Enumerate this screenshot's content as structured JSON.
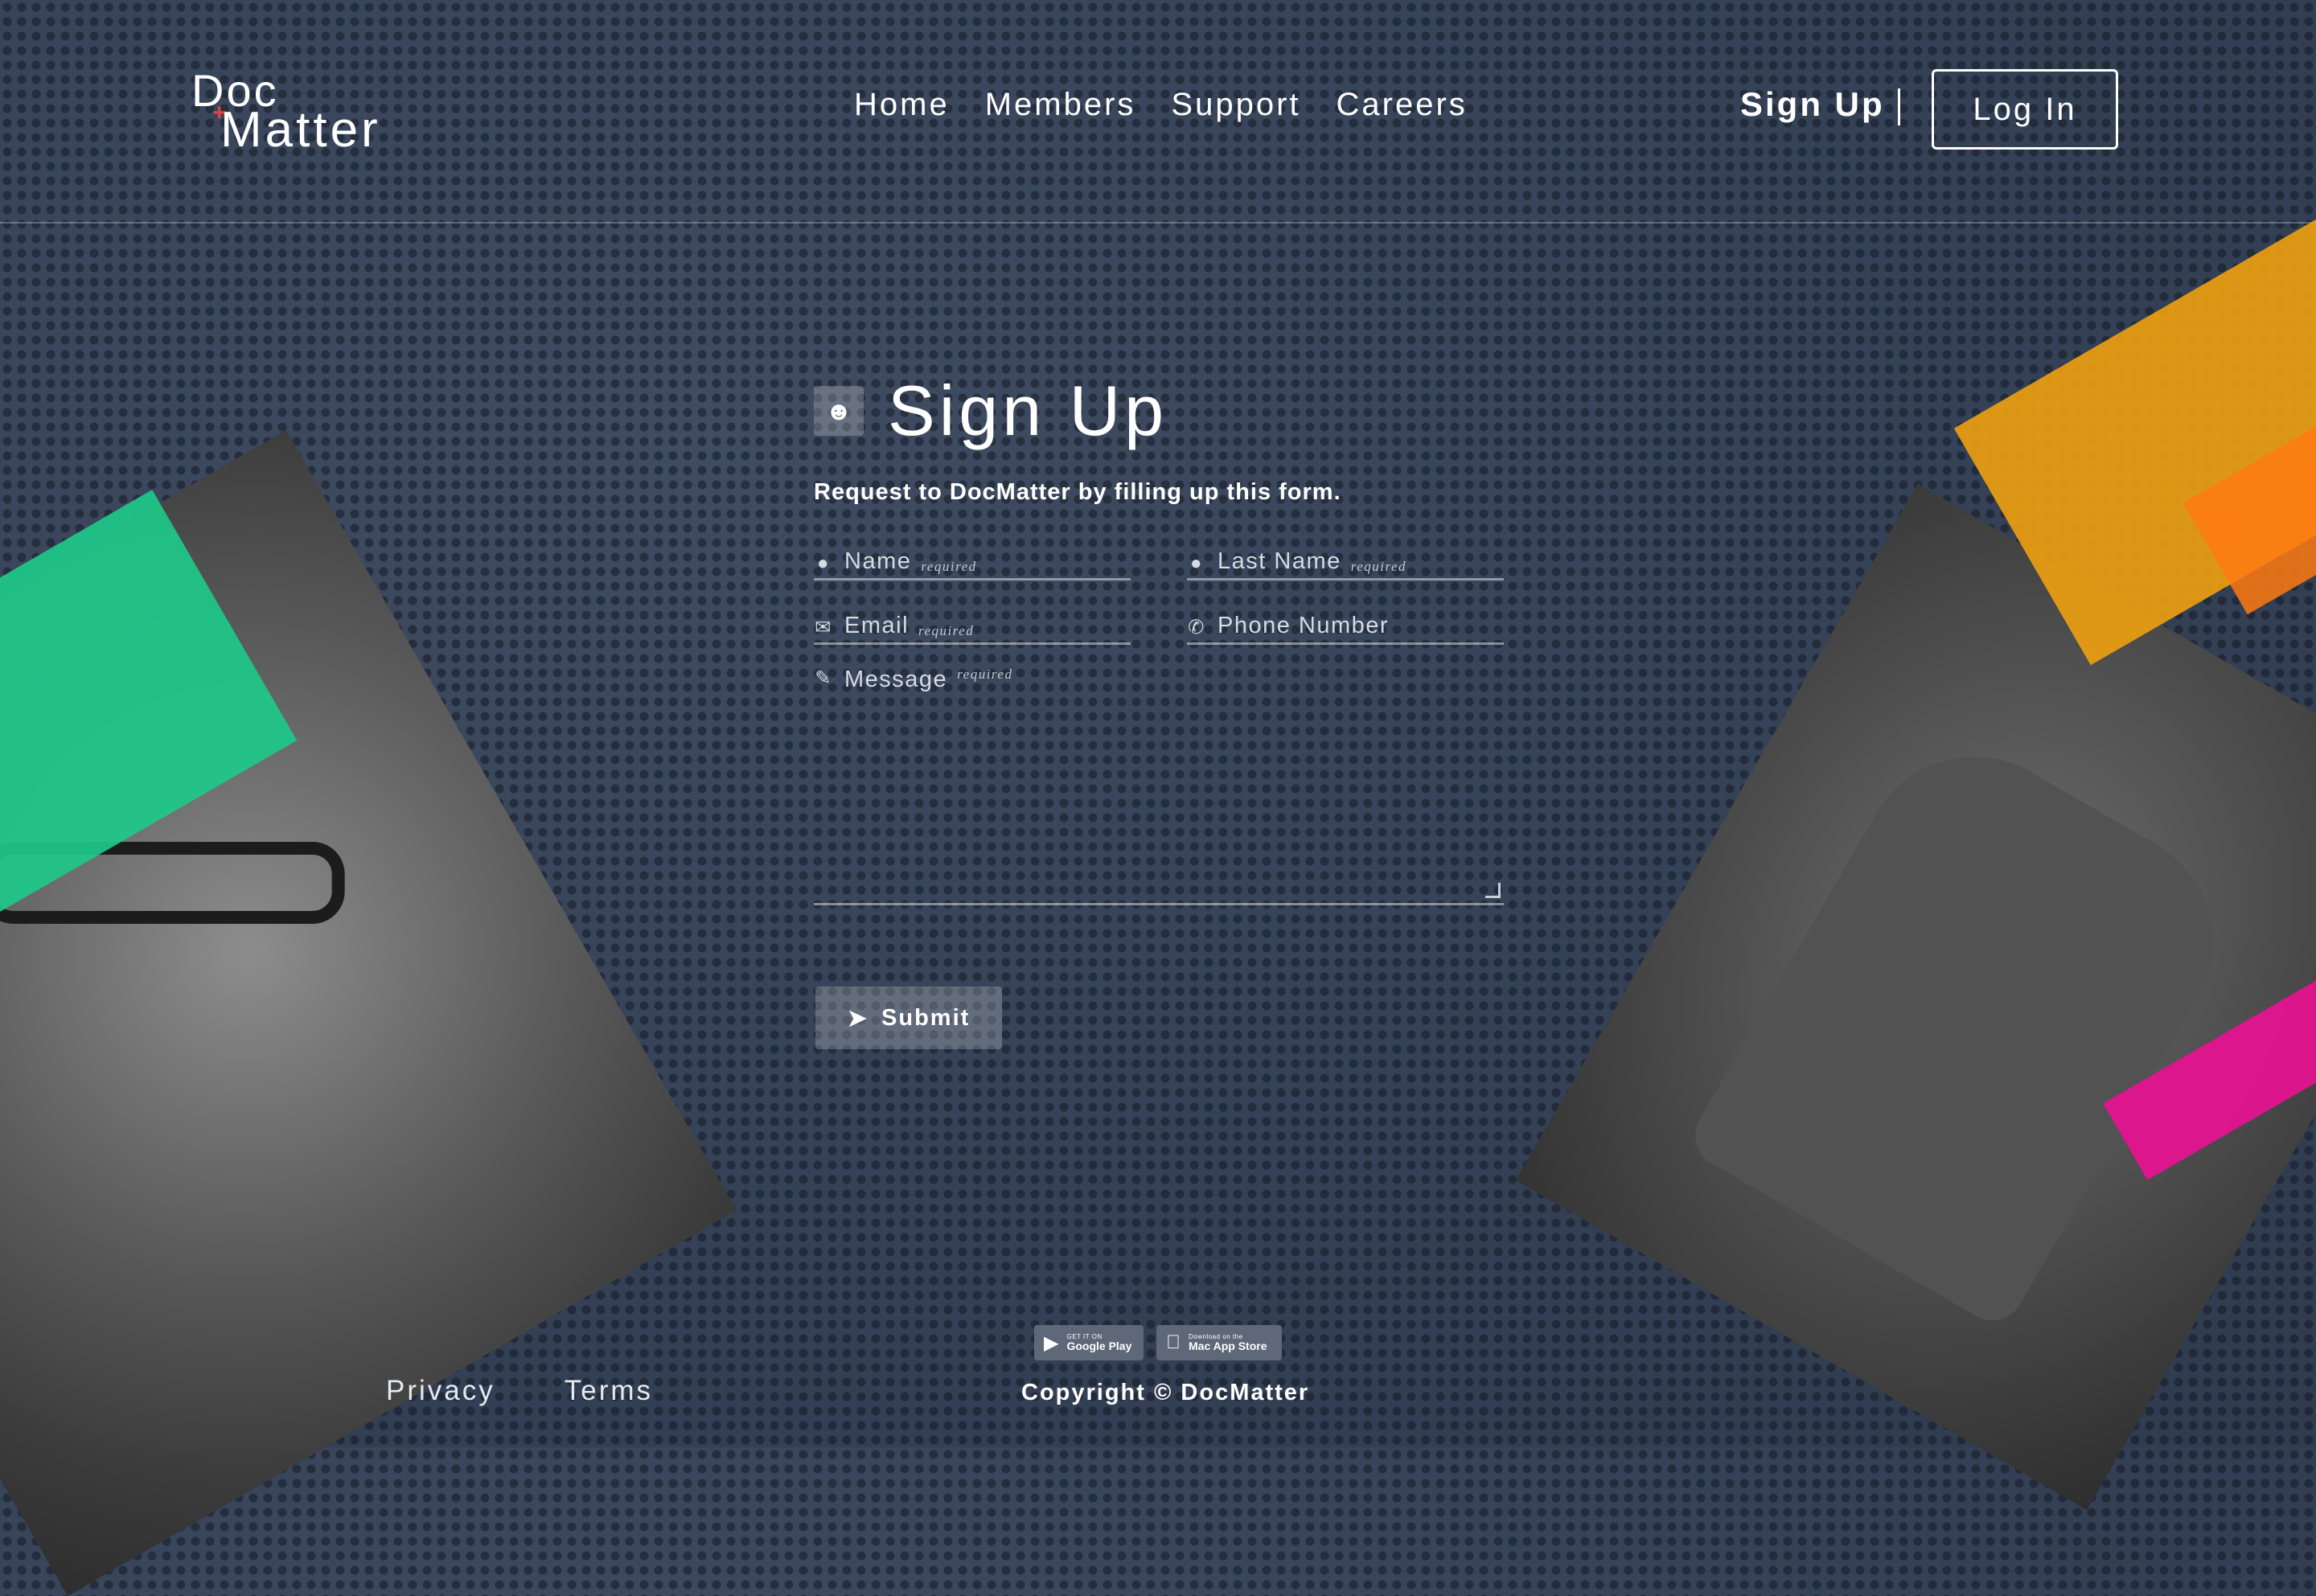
{
  "logo": {
    "line1": "Doc",
    "line2": "Matter",
    "plus": "+"
  },
  "nav": {
    "items": [
      "Home",
      "Members",
      "Support",
      "Careers"
    ]
  },
  "auth": {
    "signup": "Sign Up",
    "login": "Log In"
  },
  "form": {
    "title": "Sign Up",
    "subtitle": "Request to DocMatter by filling up this form.",
    "fields": {
      "name": {
        "label": "Name",
        "note": "required",
        "icon": "user-icon"
      },
      "last_name": {
        "label": "Last Name",
        "note": "required",
        "icon": "user-icon"
      },
      "email": {
        "label": "Email",
        "note": "required",
        "icon": "envelope-icon"
      },
      "phone": {
        "label": "Phone Number",
        "icon": "phone-icon"
      },
      "message": {
        "label": "Message",
        "note": "required",
        "icon": "pencil-icon"
      }
    },
    "submit_label": "Submit"
  },
  "footer": {
    "privacy": "Privacy",
    "terms": "Terms",
    "copyright": "Copyright © DocMatter",
    "google_play": {
      "small": "GET IT ON",
      "big": "Google Play"
    },
    "mac_app_store": {
      "small": "Download on the",
      "big": "Mac App Store"
    }
  },
  "colors": {
    "background": "#364358",
    "green": "#1ec98a",
    "orange": "#f0a10f",
    "pink": "#e4138f"
  }
}
